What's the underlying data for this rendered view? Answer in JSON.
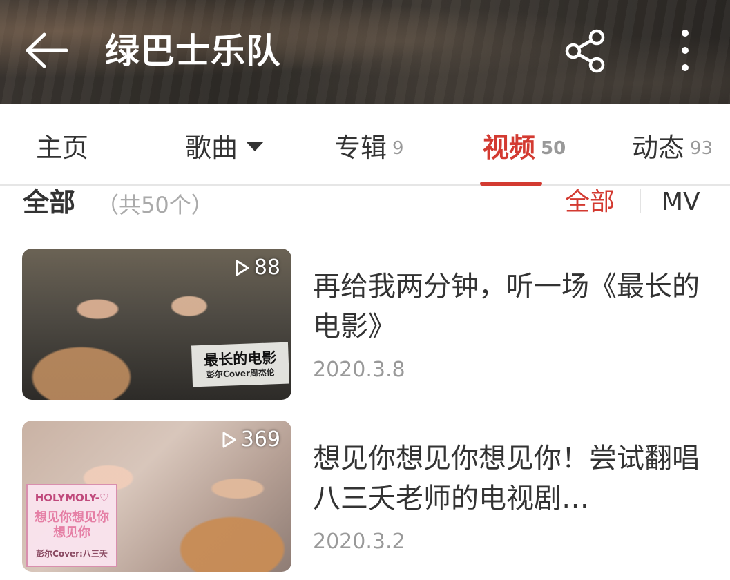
{
  "header": {
    "title": "绿巴士乐队",
    "back_icon": "arrow-left-icon",
    "share_icon": "share-icon",
    "more_icon": "more-vertical-icon"
  },
  "tabs": [
    {
      "label": "主页",
      "count": ""
    },
    {
      "label": "歌曲",
      "count": ""
    },
    {
      "label": "专辑",
      "count": "9"
    },
    {
      "label": "视频",
      "count": "50"
    },
    {
      "label": "动态",
      "count": "93"
    }
  ],
  "active_tab": "视频",
  "filter": {
    "title": "全部",
    "count_text": "（共50个）",
    "option_all": "全部",
    "option_mv": "MV"
  },
  "videos": [
    {
      "play_count": "88",
      "title": "再给我两分钟，听一场《最长的电影》",
      "date": "2020.3.8",
      "thumb_caption": "最长的电影",
      "thumb_subcaption": "彭尔Cover周杰伦"
    },
    {
      "play_count": "369",
      "title": "想见你想见你想见你！尝试翻唱八三夭老师的电视剧…",
      "date": "2020.3.2",
      "thumb_tag": "HOLYMOLY-♡",
      "thumb_caption": "想见你想见你想见你",
      "thumb_subcaption": "彭尔Cover:八三夭"
    }
  ],
  "colors": {
    "accent": "#d33a31",
    "text_primary": "#333333",
    "text_secondary": "#999999"
  }
}
